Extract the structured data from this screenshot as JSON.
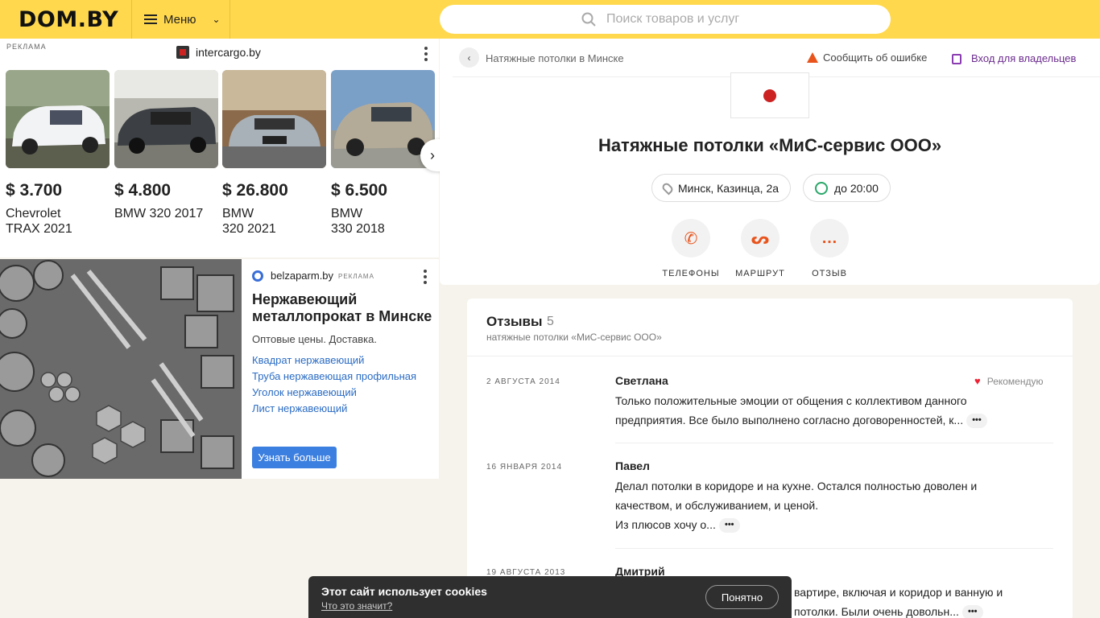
{
  "header": {
    "logo": "DOM.BY",
    "menu_label": "Меню",
    "search_placeholder": "Поиск товаров и услуг"
  },
  "ad1": {
    "label": "РЕКЛАМА",
    "domain": "intercargo.by",
    "cars": [
      {
        "price": "$ 3.700",
        "name": "Chevrolet TRAX 2021"
      },
      {
        "price": "$ 4.800",
        "name": "BMW 320 2017"
      },
      {
        "price": "$ 26.800",
        "name": "BMW 320 2021"
      },
      {
        "price": "$ 6.500",
        "name": "BMW 330 2018"
      }
    ]
  },
  "ad2": {
    "domain": "belzaparm.by",
    "label": "РЕКЛАМА",
    "title": "Нержавеющий металлопрокат в Минске",
    "desc": "Оптовые цены. Доставка.",
    "links": [
      "Квадрат нержавеющий",
      "Труба нержавеющая профильная",
      "Уголок нержавеющий",
      "Лист нержавеющий"
    ],
    "cta": "Узнать больше"
  },
  "card": {
    "breadcrumb": "Натяжные потолки в Минске",
    "report": "Сообщить об ошибке",
    "owner_login": "Вход для владельцев",
    "title": "Натяжные потолки «МиС-сервис ООО»",
    "address": "Минск, Казинца, 2а",
    "hours": "до 20:00",
    "actions": [
      "ТЕЛЕФОНЫ",
      "МАРШРУТ",
      "ОТЗЫВ"
    ]
  },
  "reviews": {
    "title": "Отзывы",
    "count": "5",
    "subtitle": "натяжные потолки «МиС-сервис ООО»",
    "recommend": "Рекомендую",
    "items": [
      {
        "date": "2 АВГУСТА 2014",
        "author": "Светлана",
        "text": "Только положительные эмоции от общения с коллективом данного предприятия. Все было выполнено согласно договоренностей, к..."
      },
      {
        "date": "16 ЯНВАРЯ 2014",
        "author": "Павел",
        "text1": "Делал потолки в коридоре и на кухне. Остался полностью доволен и качеством, и обслуживанием, и ценой.",
        "text2": "Из плюсов хочу о..."
      },
      {
        "date": "19 АВГУСТА 2013",
        "author": "Дмитрий",
        "text1": "вартире, включая и коридор и ванную и",
        "text2": "потолки. Были очень довольн..."
      }
    ]
  },
  "cookie": {
    "title": "Этот сайт использует cookies",
    "link": "Что это значит?",
    "button": "Понятно"
  },
  "colors": {
    "header": "#ffd84d",
    "accent": "#e8541c",
    "link": "#2b6cc4",
    "owner": "#6b2c8e"
  }
}
